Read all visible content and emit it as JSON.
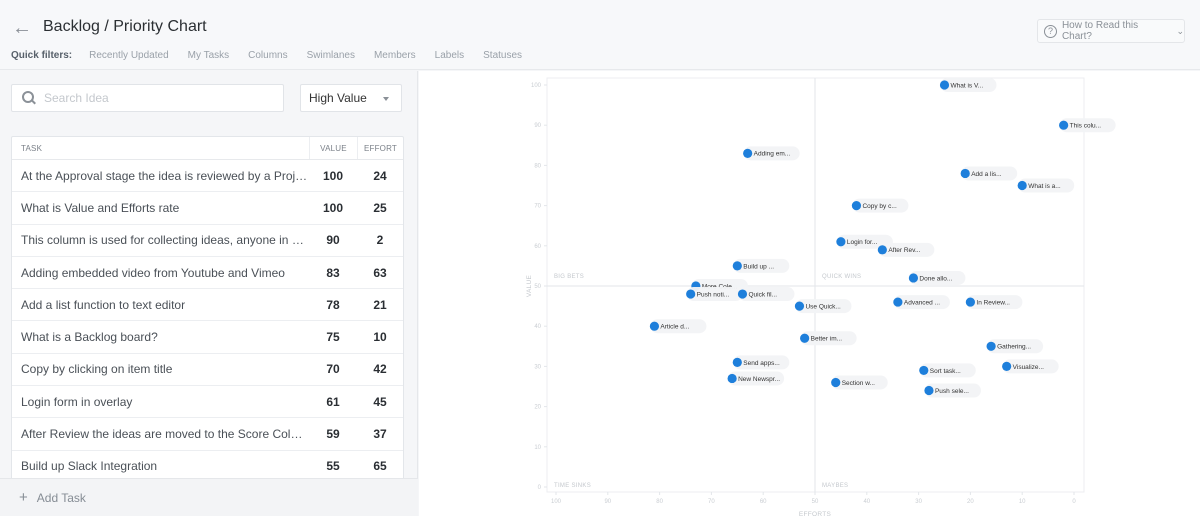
{
  "header": {
    "title": "Backlog / Priority Chart",
    "quick_filters_label": "Quick filters:",
    "quick_filters": [
      "Recently Updated",
      "My Tasks",
      "Columns",
      "Swimlanes",
      "Members",
      "Labels",
      "Statuses"
    ],
    "help_button": "How to Read this Chart?"
  },
  "sidebar": {
    "search_placeholder": "Search Idea",
    "search_value": "",
    "sort_select": "High Value",
    "table": {
      "columns": [
        "TASK",
        "VALUE",
        "EFFORT"
      ],
      "rows": [
        {
          "task": "At the Approval stage the idea is reviewed by a Project Manager",
          "value": "100",
          "effort": "24"
        },
        {
          "task": "What is Value and Efforts rate",
          "value": "100",
          "effort": "25"
        },
        {
          "task": "This column is used for collecting ideas, anyone in your team",
          "value": "90",
          "effort": "2"
        },
        {
          "task": "Adding embedded video from Youtube and Vimeo",
          "value": "83",
          "effort": "63"
        },
        {
          "task": "Add a list function to text editor",
          "value": "78",
          "effort": "21"
        },
        {
          "task": "What is a Backlog board?",
          "value": "75",
          "effort": "10"
        },
        {
          "task": "Copy by clicking on item title",
          "value": "70",
          "effort": "42"
        },
        {
          "task": "Login form in overlay",
          "value": "61",
          "effort": "45"
        },
        {
          "task": "After Review the ideas are moved to the Score Column",
          "value": "59",
          "effort": "37"
        },
        {
          "task": "Build up Slack Integration",
          "value": "55",
          "effort": "65"
        }
      ]
    },
    "add_task": "Add Task"
  },
  "colors": {
    "point": "#1e7fdb",
    "accent": "#1e7fdb"
  },
  "chart_data": {
    "type": "scatter",
    "title": "",
    "xlabel": "EFFORTS",
    "ylabel": "VALUE",
    "xlim": [
      100,
      0
    ],
    "ylim": [
      0,
      100
    ],
    "x_reversed": true,
    "xticks": [
      100,
      90,
      80,
      70,
      60,
      50,
      40,
      30,
      20,
      10,
      0
    ],
    "yticks": [
      0,
      10,
      20,
      30,
      40,
      50,
      60,
      70,
      80,
      90,
      100
    ],
    "grid": false,
    "quadrant_dividers": {
      "x": 50,
      "y": 50
    },
    "quadrants": {
      "top_left": "BIG BETS",
      "top_right": "QUICK WINS",
      "bottom_left": "TIME SINKS",
      "bottom_right": "MAYBES"
    },
    "points": [
      {
        "label": "What is V...",
        "effort": 25,
        "value": 100
      },
      {
        "label": "This colu...",
        "effort": 2,
        "value": 90
      },
      {
        "label": "Adding em...",
        "effort": 63,
        "value": 83
      },
      {
        "label": "Add a lis...",
        "effort": 21,
        "value": 78
      },
      {
        "label": "What is a...",
        "effort": 10,
        "value": 75
      },
      {
        "label": "Copy by c...",
        "effort": 42,
        "value": 70
      },
      {
        "label": "Login for...",
        "effort": 45,
        "value": 61
      },
      {
        "label": "After Rev...",
        "effort": 37,
        "value": 59
      },
      {
        "label": "Build up ...",
        "effort": 65,
        "value": 55
      },
      {
        "label": "Done allo...",
        "effort": 31,
        "value": 52
      },
      {
        "label": "More Cole...",
        "effort": 73,
        "value": 50
      },
      {
        "label": "Push noti...",
        "effort": 74,
        "value": 48
      },
      {
        "label": "Quick fil...",
        "effort": 64,
        "value": 48
      },
      {
        "label": "Advanced ...",
        "effort": 34,
        "value": 46
      },
      {
        "label": "In Review...",
        "effort": 20,
        "value": 46
      },
      {
        "label": "Use Quick...",
        "effort": 53,
        "value": 45
      },
      {
        "label": "Article d...",
        "effort": 81,
        "value": 40
      },
      {
        "label": "Better im...",
        "effort": 52,
        "value": 37
      },
      {
        "label": "Gathering...",
        "effort": 16,
        "value": 35
      },
      {
        "label": "Send apps...",
        "effort": 65,
        "value": 31
      },
      {
        "label": "Visualize...",
        "effort": 13,
        "value": 30
      },
      {
        "label": "Sort task...",
        "effort": 29,
        "value": 29
      },
      {
        "label": "New Newspr...",
        "effort": 66,
        "value": 27
      },
      {
        "label": "Section w...",
        "effort": 46,
        "value": 26
      },
      {
        "label": "Push sele...",
        "effort": 28,
        "value": 24
      }
    ]
  }
}
